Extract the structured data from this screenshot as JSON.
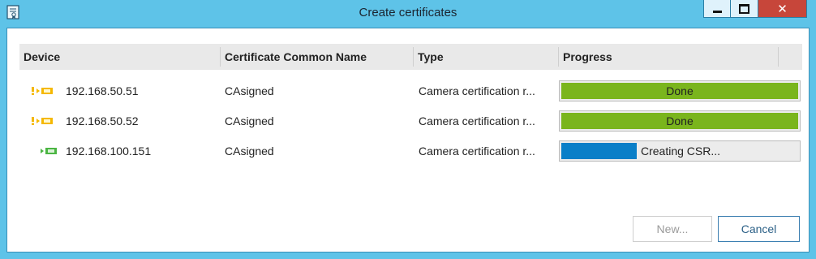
{
  "window": {
    "title": "Create certificates",
    "icon": "certificate-icon",
    "controls": [
      "minimize-icon",
      "maximize-icon",
      "close-icon"
    ]
  },
  "table": {
    "columns": [
      "Device",
      "Certificate Common Name",
      "Type",
      "Progress"
    ],
    "rows": [
      {
        "device": "192.168.50.51",
        "device_icon": "camera-warning-icon",
        "common_name": "CAsigned",
        "type": "Camera certification r...",
        "progress_label": "Done",
        "progress_fraction": 1.0
      },
      {
        "device": "192.168.50.52",
        "device_icon": "camera-warning-icon",
        "common_name": "CAsigned",
        "type": "Camera certification r...",
        "progress_label": "Done",
        "progress_fraction": 1.0
      },
      {
        "device": "192.168.100.151",
        "device_icon": "camera-icon",
        "common_name": "CAsigned",
        "type": "Camera certification r...",
        "progress_label": "Creating CSR...",
        "progress_fraction": 0.32
      }
    ]
  },
  "buttons": {
    "new_label": "New...",
    "cancel_label": "Cancel"
  },
  "colors": {
    "title_bar": "#5ec3e8",
    "progress_done": "#7ab51d",
    "progress_active": "#0a7fc8",
    "device_green": "#4bb543",
    "warning_yellow": "#f5b800",
    "close_red": "#c7463a"
  }
}
